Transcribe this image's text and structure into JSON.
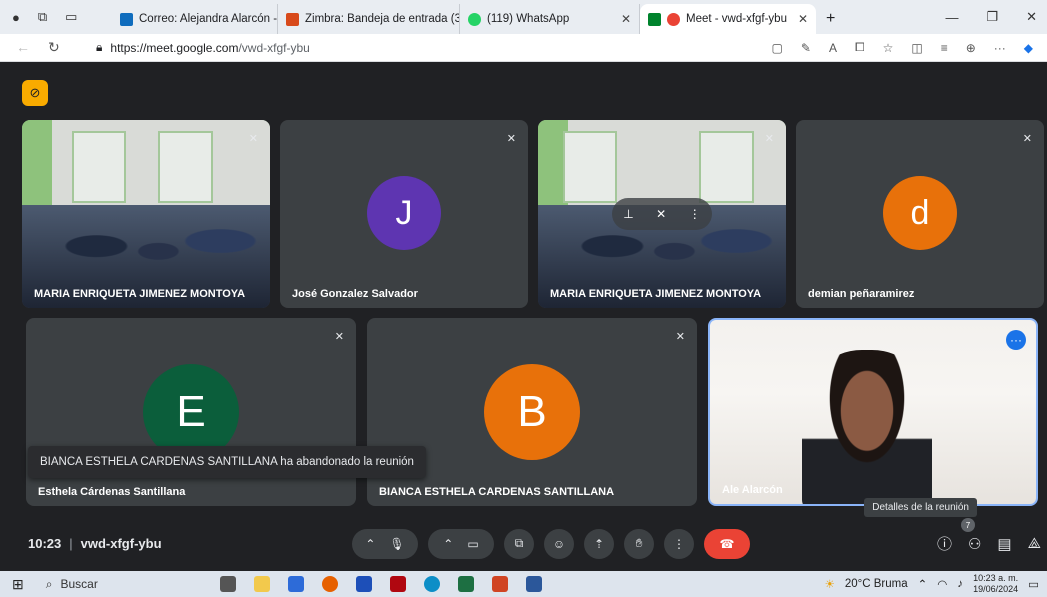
{
  "browser": {
    "tabs": [
      {
        "label": "Correo: Alejandra Alarcón - Outl",
        "color": "#0f6cbd"
      },
      {
        "label": "Zimbra: Bandeja de entrada (378",
        "color": "#d84a1b"
      },
      {
        "label": "(119) WhatsApp",
        "color": "#25d366"
      },
      {
        "label": "Meet - vwd-xfgf-ybu",
        "color": "#ea4335"
      }
    ],
    "url_host": "https://meet.google.com",
    "url_path": "/vwd-xfgf-ybu"
  },
  "participants": [
    {
      "name": "MARIA ENRIQUETA JIMENEZ MONTOYA",
      "kind": "video"
    },
    {
      "name": "José Gonzalez Salvador",
      "initial": "J",
      "color": "#5e35b1"
    },
    {
      "name": "MARIA ENRIQUETA JIMENEZ MONTOYA",
      "kind": "video"
    },
    {
      "name": "demian peñaramirez",
      "initial": "d",
      "color": "#e8710a"
    },
    {
      "name": "Esthela Cárdenas Santillana",
      "initial": "E",
      "color": "#0b5e3b"
    },
    {
      "name": "BIANCA ESTHELA CARDENAS SANTILLANA",
      "initial": "B",
      "color": "#e8710a"
    },
    {
      "name": "Ale Alarcón",
      "kind": "self"
    }
  ],
  "toast": "BIANCA ESTHELA CARDENAS SANTILLANA ha abandonado la reunión",
  "meeting": {
    "time": "10:23",
    "code": "vwd-xfgf-ybu"
  },
  "tooltip": "Detalles de la reunión",
  "people_count": "7",
  "taskbar": {
    "search": "Buscar",
    "weather": "20°C  Bruma",
    "time": "10:23 a. m.",
    "date": "19/06/2024"
  }
}
